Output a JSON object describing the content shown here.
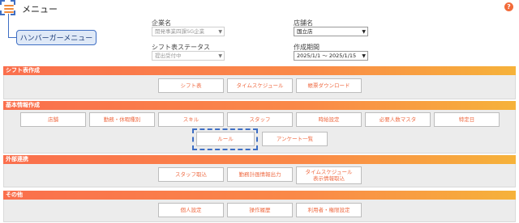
{
  "header": {
    "title": "メニュー",
    "hamburger_callout": "ハンバーガーメニュー",
    "help_symbol": "?"
  },
  "filters": {
    "company_label": "企業名",
    "company_value": "開発事業四課SG企業",
    "store_label": "店舗名",
    "store_value": "国立店",
    "status_label": "シフト表ステータス",
    "status_value": "提出受付中",
    "period_label": "作成期間",
    "period_value": "2025/1/1 ～ 2025/1/15"
  },
  "sections": {
    "shift": {
      "title": "シフト表作成",
      "buttons": [
        "シフト表",
        "タイムスケジュール",
        "帳票ダウンロード"
      ]
    },
    "basic": {
      "title": "基本情報作成",
      "row1": [
        "店舗",
        "勤務・休暇種別",
        "スキル",
        "スタッフ",
        "時給設定",
        "必要人数マスタ",
        "特定日"
      ],
      "row2": [
        "ルール",
        "アンケート一覧"
      ]
    },
    "external": {
      "title": "外部連携",
      "buttons": [
        "スタッフ取込",
        "勤務計画情報出力",
        "タイムスケジュール\n表示情報取込"
      ]
    },
    "other": {
      "title": "その他",
      "buttons": [
        "個人設定",
        "操作履歴",
        "利用者・権限設定"
      ]
    }
  },
  "colors": {
    "header_gradient_start": "#fa6f4d",
    "header_gradient_end": "#f6b23a",
    "button_text": "#ef6a42",
    "annotation_blue": "#3f6fc4"
  }
}
